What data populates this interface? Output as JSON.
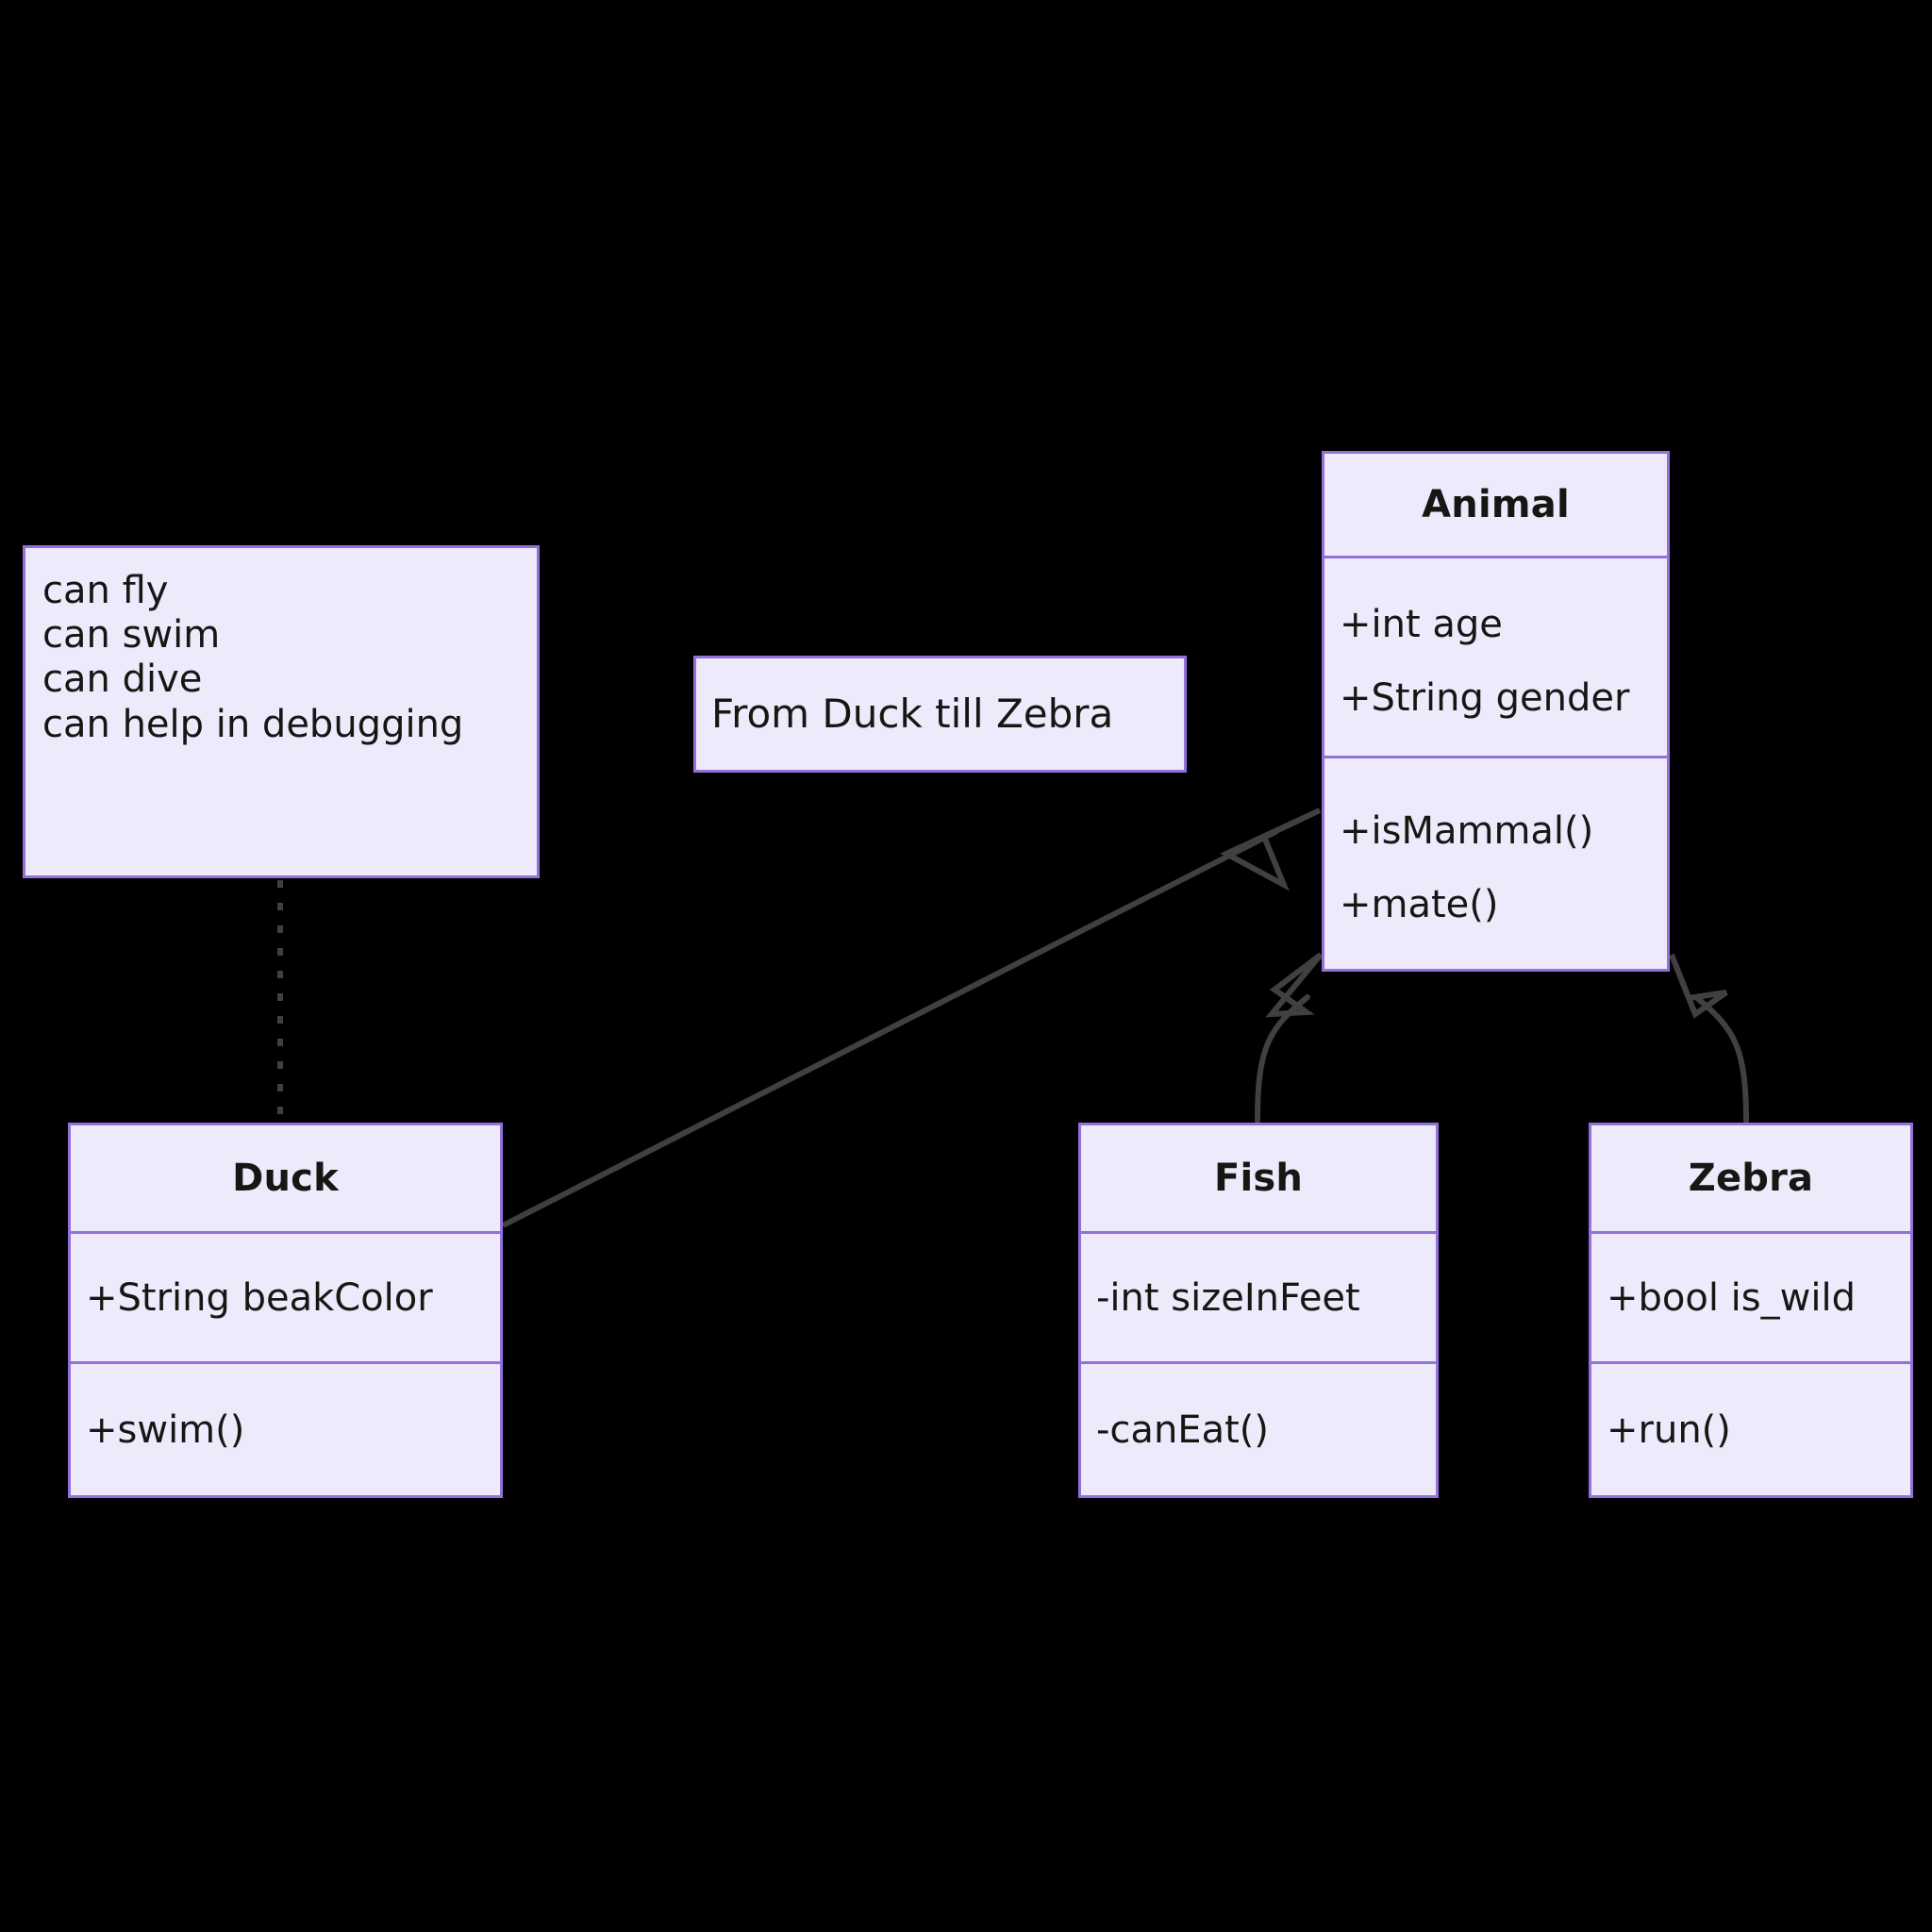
{
  "diagram": {
    "type": "uml-class-diagram",
    "background_color": "#000000",
    "box_fill_color": "#ECEAFB",
    "box_border_color": "#9370DB",
    "text_color": "#161613",
    "edge_color": "#404040"
  },
  "note": {
    "lines": [
      "can fly",
      "can swim",
      "can dive",
      "can help in debugging"
    ]
  },
  "label": {
    "text": "From Duck till Zebra"
  },
  "classes": [
    {
      "id": "animal",
      "name": "Animal",
      "attributes": [
        "+int age",
        "+String gender"
      ],
      "methods": [
        "+isMammal()",
        "+mate()"
      ]
    },
    {
      "id": "duck",
      "name": "Duck",
      "attributes": [
        "+String beakColor"
      ],
      "methods": [
        "+swim()"
      ]
    },
    {
      "id": "fish",
      "name": "Fish",
      "attributes": [
        "-int sizeInFeet"
      ],
      "methods": [
        "-canEat()"
      ]
    },
    {
      "id": "zebra",
      "name": "Zebra",
      "attributes": [
        "+bool is_wild"
      ],
      "methods": [
        "+run()"
      ]
    }
  ],
  "relationships": [
    {
      "from": "duck",
      "to": "animal",
      "kind": "inheritance",
      "style": "solid",
      "arrow": "hollow-triangle"
    },
    {
      "from": "fish",
      "to": "animal",
      "kind": "inheritance",
      "style": "solid",
      "arrow": "hollow-triangle"
    },
    {
      "from": "zebra",
      "to": "animal",
      "kind": "inheritance",
      "style": "solid",
      "arrow": "hollow-triangle"
    },
    {
      "from": "note",
      "to": "duck",
      "kind": "note-link",
      "style": "dotted",
      "arrow": "none"
    }
  ]
}
